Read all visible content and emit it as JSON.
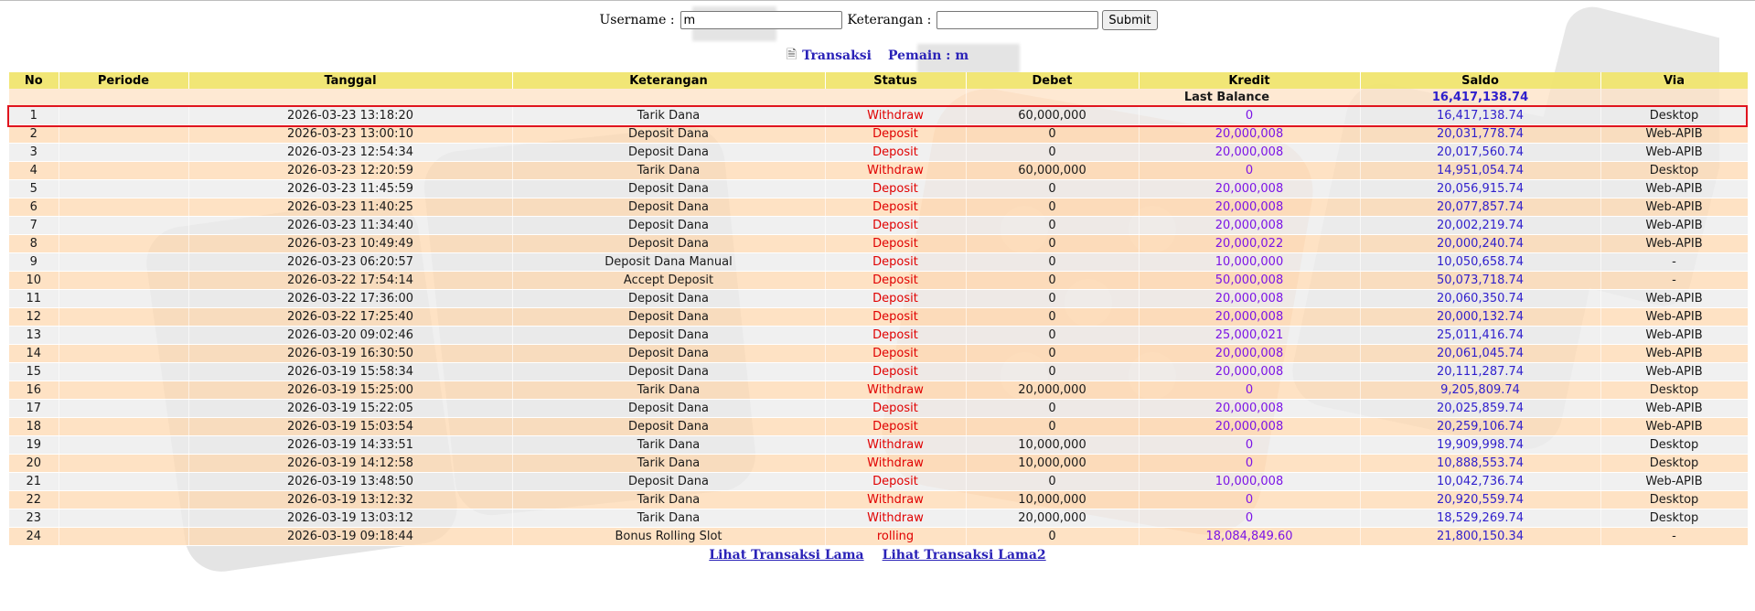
{
  "form": {
    "username_label": "Username :",
    "username_value": "m",
    "keterangan_label": "Keterangan :",
    "keterangan_value": "",
    "submit_label": "Submit"
  },
  "heading": {
    "transaksi_label": "Transaksi",
    "pemain_label": "Pemain : m"
  },
  "table": {
    "headers": [
      "No",
      "Periode",
      "Tanggal",
      "Keterangan",
      "Status",
      "Debet",
      "Kredit",
      "Saldo",
      "Via"
    ],
    "last_balance_label": "Last Balance",
    "last_balance_value": "16,417,138.74",
    "rows": [
      {
        "no": "1",
        "periode": "",
        "tanggal": "2026-03-23 13:18:20",
        "keterangan": "Tarik Dana",
        "status": "Withdraw",
        "debet": "60,000,000",
        "kredit": "0",
        "saldo": "16,417,138.74",
        "via": "Desktop"
      },
      {
        "no": "2",
        "periode": "",
        "tanggal": "2026-03-23 13:00:10",
        "keterangan": "Deposit Dana",
        "status": "Deposit",
        "debet": "0",
        "kredit": "20,000,008",
        "saldo": "20,031,778.74",
        "via": "Web-APIB"
      },
      {
        "no": "3",
        "periode": "",
        "tanggal": "2026-03-23 12:54:34",
        "keterangan": "Deposit Dana",
        "status": "Deposit",
        "debet": "0",
        "kredit": "20,000,008",
        "saldo": "20,017,560.74",
        "via": "Web-APIB"
      },
      {
        "no": "4",
        "periode": "",
        "tanggal": "2026-03-23 12:20:59",
        "keterangan": "Tarik Dana",
        "status": "Withdraw",
        "debet": "60,000,000",
        "kredit": "0",
        "saldo": "14,951,054.74",
        "via": "Desktop"
      },
      {
        "no": "5",
        "periode": "",
        "tanggal": "2026-03-23 11:45:59",
        "keterangan": "Deposit Dana",
        "status": "Deposit",
        "debet": "0",
        "kredit": "20,000,008",
        "saldo": "20,056,915.74",
        "via": "Web-APIB"
      },
      {
        "no": "6",
        "periode": "",
        "tanggal": "2026-03-23 11:40:25",
        "keterangan": "Deposit Dana",
        "status": "Deposit",
        "debet": "0",
        "kredit": "20,000,008",
        "saldo": "20,077,857.74",
        "via": "Web-APIB"
      },
      {
        "no": "7",
        "periode": "",
        "tanggal": "2026-03-23 11:34:40",
        "keterangan": "Deposit Dana",
        "status": "Deposit",
        "debet": "0",
        "kredit": "20,000,008",
        "saldo": "20,002,219.74",
        "via": "Web-APIB"
      },
      {
        "no": "8",
        "periode": "",
        "tanggal": "2026-03-23 10:49:49",
        "keterangan": "Deposit Dana",
        "status": "Deposit",
        "debet": "0",
        "kredit": "20,000,022",
        "saldo": "20,000,240.74",
        "via": "Web-APIB"
      },
      {
        "no": "9",
        "periode": "",
        "tanggal": "2026-03-23 06:20:57",
        "keterangan": "Deposit Dana Manual",
        "status": "Deposit",
        "debet": "0",
        "kredit": "10,000,000",
        "saldo": "10,050,658.74",
        "via": "-"
      },
      {
        "no": "10",
        "periode": "",
        "tanggal": "2026-03-22 17:54:14",
        "keterangan": "Accept Deposit",
        "status": "Deposit",
        "debet": "0",
        "kredit": "50,000,008",
        "saldo": "50,073,718.74",
        "via": "-"
      },
      {
        "no": "11",
        "periode": "",
        "tanggal": "2026-03-22 17:36:00",
        "keterangan": "Deposit Dana",
        "status": "Deposit",
        "debet": "0",
        "kredit": "20,000,008",
        "saldo": "20,060,350.74",
        "via": "Web-APIB"
      },
      {
        "no": "12",
        "periode": "",
        "tanggal": "2026-03-22 17:25:40",
        "keterangan": "Deposit Dana",
        "status": "Deposit",
        "debet": "0",
        "kredit": "20,000,008",
        "saldo": "20,000,132.74",
        "via": "Web-APIB"
      },
      {
        "no": "13",
        "periode": "",
        "tanggal": "2026-03-20 09:02:46",
        "keterangan": "Deposit Dana",
        "status": "Deposit",
        "debet": "0",
        "kredit": "25,000,021",
        "saldo": "25,011,416.74",
        "via": "Web-APIB"
      },
      {
        "no": "14",
        "periode": "",
        "tanggal": "2026-03-19 16:30:50",
        "keterangan": "Deposit Dana",
        "status": "Deposit",
        "debet": "0",
        "kredit": "20,000,008",
        "saldo": "20,061,045.74",
        "via": "Web-APIB"
      },
      {
        "no": "15",
        "periode": "",
        "tanggal": "2026-03-19 15:58:34",
        "keterangan": "Deposit Dana",
        "status": "Deposit",
        "debet": "0",
        "kredit": "20,000,008",
        "saldo": "20,111,287.74",
        "via": "Web-APIB"
      },
      {
        "no": "16",
        "periode": "",
        "tanggal": "2026-03-19 15:25:00",
        "keterangan": "Tarik Dana",
        "status": "Withdraw",
        "debet": "20,000,000",
        "kredit": "0",
        "saldo": "9,205,809.74",
        "via": "Desktop"
      },
      {
        "no": "17",
        "periode": "",
        "tanggal": "2026-03-19 15:22:05",
        "keterangan": "Deposit Dana",
        "status": "Deposit",
        "debet": "0",
        "kredit": "20,000,008",
        "saldo": "20,025,859.74",
        "via": "Web-APIB"
      },
      {
        "no": "18",
        "periode": "",
        "tanggal": "2026-03-19 15:03:54",
        "keterangan": "Deposit Dana",
        "status": "Deposit",
        "debet": "0",
        "kredit": "20,000,008",
        "saldo": "20,259,106.74",
        "via": "Web-APIB"
      },
      {
        "no": "19",
        "periode": "",
        "tanggal": "2026-03-19 14:33:51",
        "keterangan": "Tarik Dana",
        "status": "Withdraw",
        "debet": "10,000,000",
        "kredit": "0",
        "saldo": "19,909,998.74",
        "via": "Desktop"
      },
      {
        "no": "20",
        "periode": "",
        "tanggal": "2026-03-19 14:12:58",
        "keterangan": "Tarik Dana",
        "status": "Withdraw",
        "debet": "10,000,000",
        "kredit": "0",
        "saldo": "10,888,553.74",
        "via": "Desktop"
      },
      {
        "no": "21",
        "periode": "",
        "tanggal": "2026-03-19 13:48:50",
        "keterangan": "Deposit Dana",
        "status": "Deposit",
        "debet": "0",
        "kredit": "10,000,008",
        "saldo": "10,042,736.74",
        "via": "Web-APIB"
      },
      {
        "no": "22",
        "periode": "",
        "tanggal": "2026-03-19 13:12:32",
        "keterangan": "Tarik Dana",
        "status": "Withdraw",
        "debet": "10,000,000",
        "kredit": "0",
        "saldo": "20,920,559.74",
        "via": "Desktop"
      },
      {
        "no": "23",
        "periode": "",
        "tanggal": "2026-03-19 13:03:12",
        "keterangan": "Tarik Dana",
        "status": "Withdraw",
        "debet": "20,000,000",
        "kredit": "0",
        "saldo": "18,529,269.74",
        "via": "Desktop"
      },
      {
        "no": "24",
        "periode": "",
        "tanggal": "2026-03-19 09:18:44",
        "keterangan": "Bonus Rolling Slot",
        "status": "rolling",
        "debet": "0",
        "kredit": "18,084,849.60",
        "saldo": "21,800,150.34",
        "via": "-"
      }
    ]
  },
  "footer": {
    "link1": "Lihat Transaksi Lama",
    "link2": "Lihat Transaksi Lama2"
  },
  "colors": {
    "header_bg": "#f0e46c",
    "row_odd": "#ececec",
    "row_even": "#fedab4",
    "status_red": "#e00000",
    "kredit_purple": "#7b14e6",
    "saldo_blue": "#2f1fcc",
    "highlight_border": "#e0141e"
  }
}
